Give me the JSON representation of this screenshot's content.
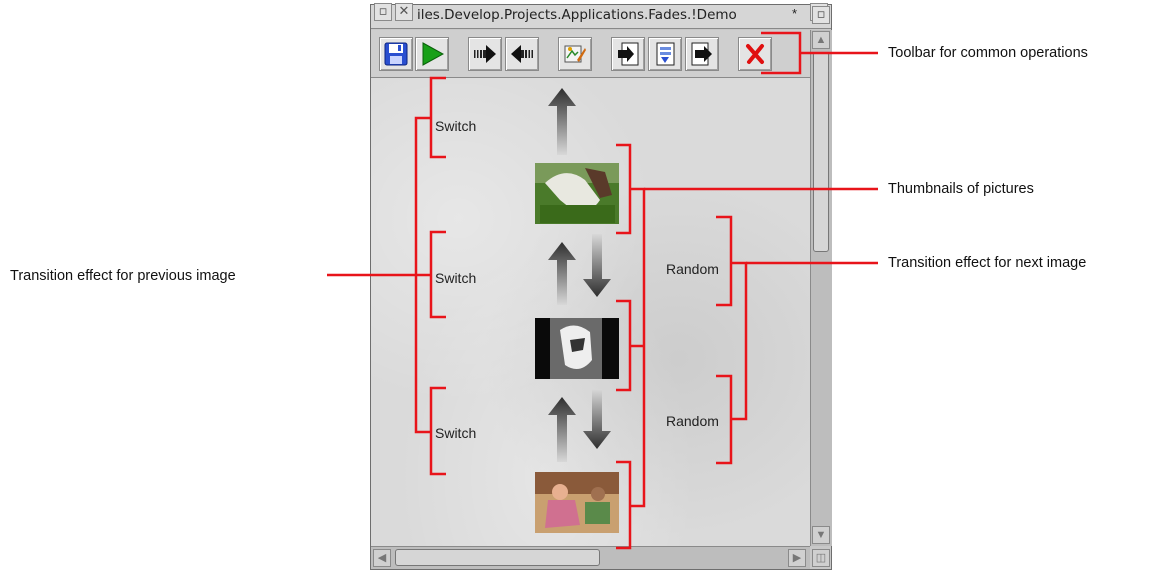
{
  "window": {
    "title": "iles.Develop.Projects.Applications.Fades.!Demo",
    "modified_marker": "*"
  },
  "toolbar": {
    "buttons": [
      {
        "name": "save",
        "icon": "floppy-disk-icon"
      },
      {
        "name": "play",
        "icon": "play-icon"
      },
      {
        "name": "move-forward",
        "icon": "arrow-right-icon"
      },
      {
        "name": "move-back",
        "icon": "arrow-left-icon"
      },
      {
        "name": "edit",
        "icon": "edit-icon"
      },
      {
        "name": "insert-before",
        "icon": "insert-icon"
      },
      {
        "name": "insert-choose",
        "icon": "choose-icon"
      },
      {
        "name": "insert-after",
        "icon": "append-icon"
      },
      {
        "name": "delete",
        "icon": "delete-icon"
      }
    ]
  },
  "sequence": {
    "transitions_previous": [
      "Switch",
      "Switch",
      "Switch"
    ],
    "transitions_next": [
      "Random",
      "Random"
    ],
    "thumbnails": [
      "horse-grazing-thumbnail",
      "horse-bw-thumbnail",
      "figures-thumbnail"
    ]
  },
  "callouts": {
    "toolbar": "Toolbar for common operations",
    "thumbnails": "Thumbnails of pictures",
    "next_effect": "Transition effect for next image",
    "prev_effect": "Transition effect for previous image"
  },
  "colors": {
    "annotation": "#e8141a",
    "play_green": "#18a018",
    "delete_red": "#e01010",
    "save_blue": "#2a4fd0"
  }
}
